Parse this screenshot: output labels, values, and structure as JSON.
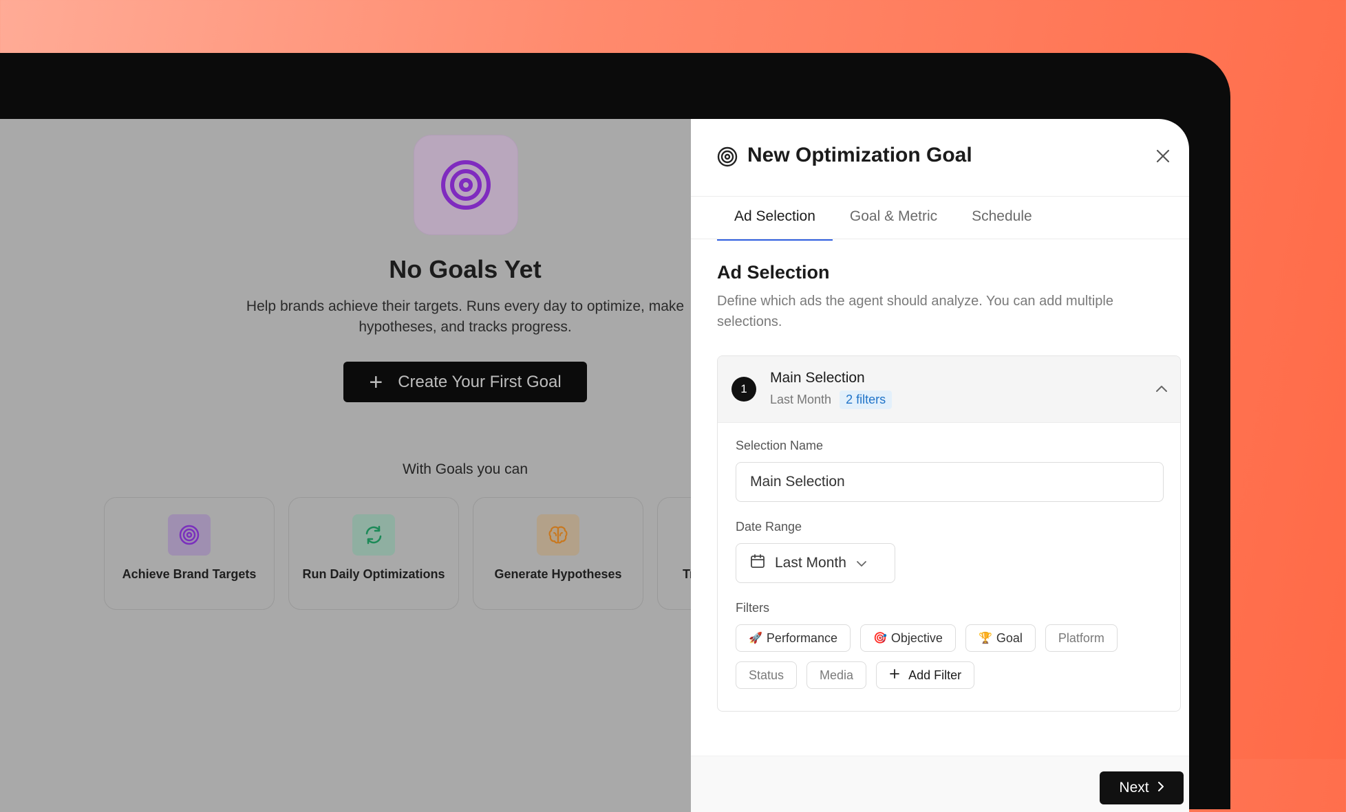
{
  "hero": {
    "title": "No Goals Yet",
    "description_line1": "Help brands achieve their targets. Runs every day to optimize, make",
    "description_line2": "hypotheses, and tracks progress.",
    "cta_label": "Create Your First Goal",
    "features_heading": "With Goals you can"
  },
  "features": [
    {
      "label": "Achieve Brand Targets",
      "icon": "target-icon",
      "color": "#8b3fd1"
    },
    {
      "label": "Run Daily Optimizations",
      "icon": "refresh-icon",
      "color": "#1f9a62"
    },
    {
      "label": "Generate Hypotheses",
      "icon": "brain-icon",
      "color": "#d98a2b"
    },
    {
      "label": "Tr",
      "icon": "",
      "color": "#777777"
    }
  ],
  "panel": {
    "title": "New Optimization Goal",
    "tabs": [
      {
        "label": "Ad Selection",
        "active": true
      },
      {
        "label": "Goal & Metric",
        "active": false
      },
      {
        "label": "Schedule",
        "active": false
      }
    ],
    "section_title": "Ad Selection",
    "section_description": "Define which ads the agent should analyze. You can add multiple selections.",
    "selection": {
      "number": "1",
      "name": "Main Selection",
      "date_summary": "Last Month",
      "filters_badge": "2 filters",
      "name_label": "Selection Name",
      "name_value": "Main Selection",
      "date_label": "Date Range",
      "date_value": "Last Month",
      "filters_label": "Filters",
      "filters": [
        {
          "label": "Performance",
          "emoji": "🚀",
          "muted": false
        },
        {
          "label": "Objective",
          "emoji": "🎯",
          "muted": false
        },
        {
          "label": "Goal",
          "emoji": "🏆",
          "muted": false
        },
        {
          "label": "Platform",
          "emoji": "",
          "muted": true
        },
        {
          "label": "Status",
          "emoji": "",
          "muted": true
        },
        {
          "label": "Media",
          "emoji": "",
          "muted": true
        }
      ],
      "add_filter_label": "Add Filter"
    },
    "next_label": "Next"
  },
  "colors": {
    "accent_tab": "#2f5fe0",
    "badge_bg": "#e3f0fb",
    "badge_text": "#1f73c8"
  }
}
